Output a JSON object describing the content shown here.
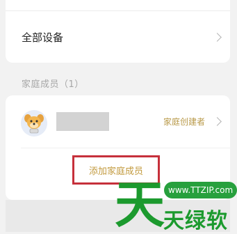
{
  "devices": {
    "all_devices_label": "全部设备"
  },
  "family": {
    "section_title": "家庭成员（1）",
    "members": [
      {
        "role": "家庭创建者"
      }
    ],
    "add_member_label": "添加家庭成员"
  },
  "watermark": {
    "url": "www.TTZIP.com",
    "big_char": "天",
    "brand": "天绿软"
  },
  "colors": {
    "accent_gold": "#b99a4a",
    "highlight_red": "#c6303b",
    "watermark_green": "#1c9a2e"
  },
  "icons": {
    "chevron": "chevron-right-icon",
    "avatar": "dog-avatar-icon"
  }
}
